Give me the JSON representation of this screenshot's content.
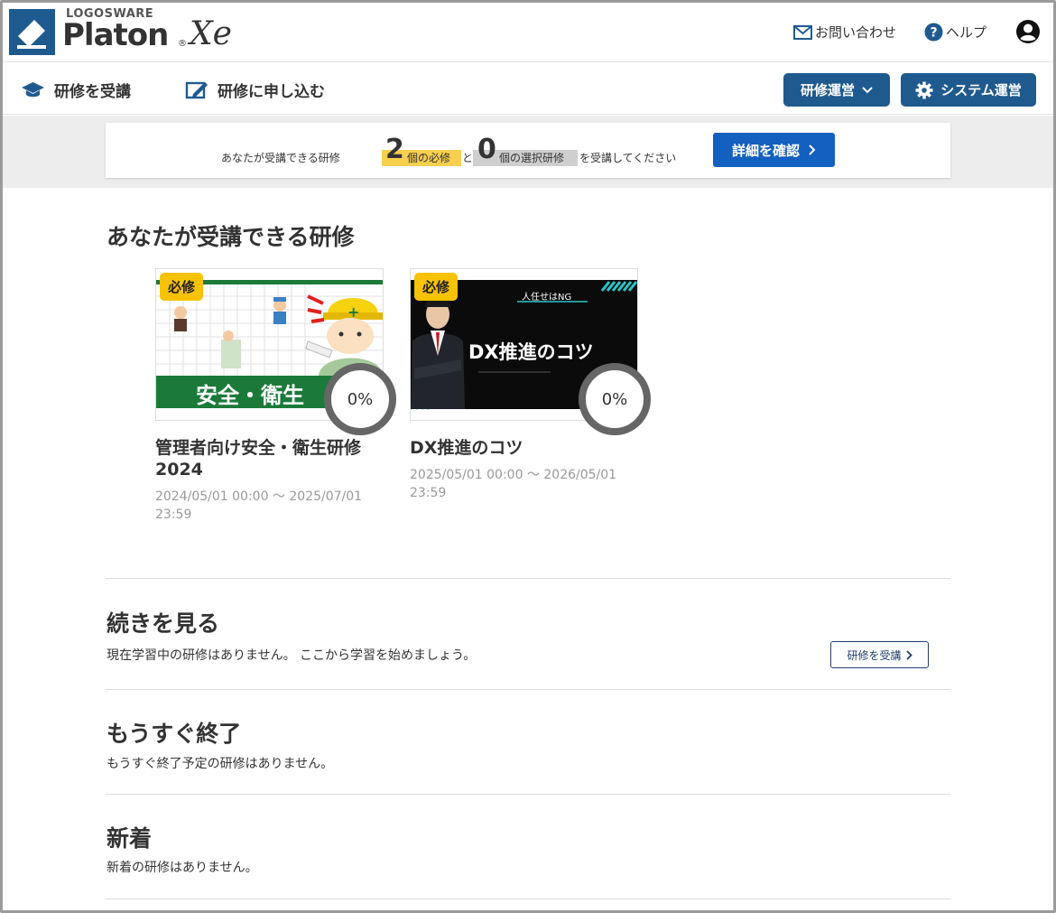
{
  "header": {
    "logo_maker": "LOGOSWARE",
    "logo_name": "Platon",
    "logo_suffix": "Xe",
    "logo_registered": "®",
    "contact_label": "お問い合わせ",
    "help_label": "ヘルプ"
  },
  "nav": {
    "attend_label": "研修を受講",
    "apply_label": "研修に申し込む",
    "training_admin_label": "研修運営",
    "system_admin_label": "システム運営"
  },
  "summary": {
    "prefix": "あなたが受講できる研修",
    "required_count": "2",
    "required_label": "個の必修",
    "connector": "と",
    "elective_count": "0",
    "elective_label": "個の選択研修",
    "suffix": "を受講してください",
    "detail_button": "詳細を確認"
  },
  "available": {
    "title": "あなたが受講できる研修",
    "courses": [
      {
        "badge": "必修",
        "thumb_caption": "安全・衛生",
        "progress": "0%",
        "title": "管理者向け安全・衛生研修2024",
        "period": "2024/05/01 00:00 〜 2025/07/01 23:59"
      },
      {
        "badge": "必修",
        "thumb_top_label": "人任せはNG",
        "thumb_caption": "DX推進のコツ",
        "progress": "0%",
        "title": "DX推進のコツ",
        "period": "2025/05/01 00:00 〜 2026/05/01 23:59"
      }
    ]
  },
  "continue": {
    "title": "続きを見る",
    "text": "現在学習中の研修はありません。 ここから学習を始めましょう。",
    "button": "研修を受講"
  },
  "ending_soon": {
    "title": "もうすぐ終了",
    "text": "もうすぐ終了予定の研修はありません。"
  },
  "new_items": {
    "title": "新着",
    "text": "新着の研修はありません。"
  },
  "colors": {
    "brand": "#1f5a8f",
    "detail_button": "#1360c0",
    "required_badge": "#f7c200",
    "highlight_yellow": "#f8cf4e",
    "highlight_gray": "#cfcfcf"
  }
}
